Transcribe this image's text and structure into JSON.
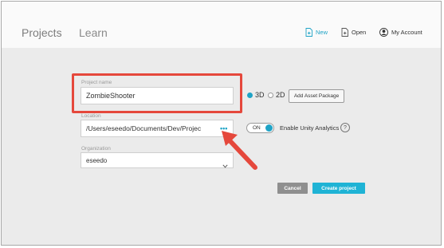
{
  "header": {
    "tabs": [
      {
        "label": "Projects"
      },
      {
        "label": "Learn"
      }
    ],
    "new_label": "New",
    "open_label": "Open",
    "account_label": "My Account"
  },
  "form": {
    "project_name_label": "Project name",
    "project_name_value": "ZombieShooter",
    "mode_3d_label": "3D",
    "mode_2d_label": "2D",
    "mode_selected": "3D",
    "add_asset_label": "Add Asset Package",
    "location_label": "Location",
    "location_value": "/Users/eseedo/Documents/Dev/Projec",
    "location_browse": "•••",
    "analytics_toggle_label": "ON",
    "analytics_label": "Enable Unity Analytics",
    "help_symbol": "?",
    "organization_label": "Organization",
    "organization_value": "eseedo"
  },
  "actions": {
    "cancel_label": "Cancel",
    "create_label": "Create project"
  },
  "colors": {
    "accent": "#1fb3d5",
    "highlight": "#e5483c",
    "cancel": "#8f8f8f"
  },
  "icons": {
    "new": "new-file-icon",
    "open": "open-file-icon",
    "account": "account-icon",
    "chevron": "chevron-down-icon",
    "annotation": "arrow-annotation-icon"
  }
}
